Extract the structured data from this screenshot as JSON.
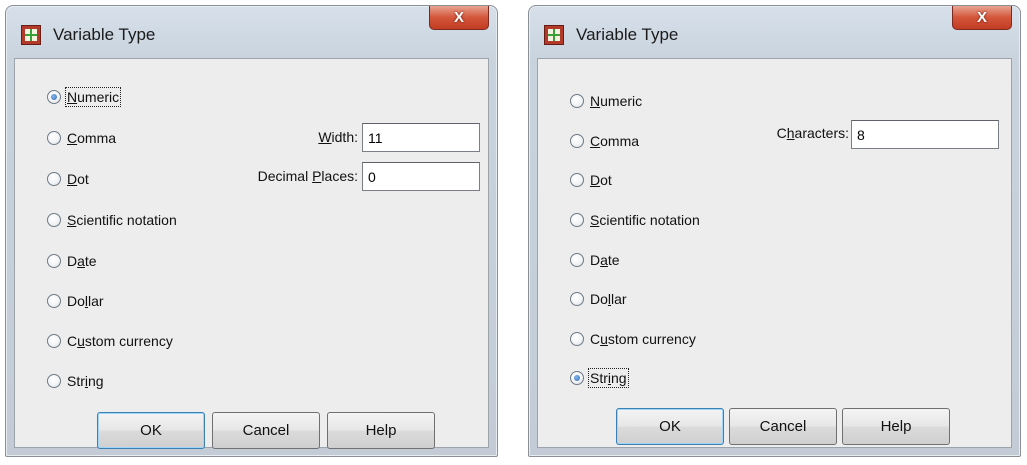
{
  "dialogs": [
    {
      "title": "Variable Type",
      "close_label": "X",
      "options": [
        {
          "pre": "",
          "key": "N",
          "post": "umeric",
          "selected": true
        },
        {
          "pre": "",
          "key": "C",
          "post": "omma",
          "selected": false
        },
        {
          "pre": "",
          "key": "D",
          "post": "ot",
          "selected": false
        },
        {
          "pre": "",
          "key": "S",
          "post": "cientific notation",
          "selected": false
        },
        {
          "pre": "D",
          "key": "a",
          "post": "te",
          "selected": false
        },
        {
          "pre": "Do",
          "key": "l",
          "post": "lar",
          "selected": false
        },
        {
          "pre": "C",
          "key": "u",
          "post": "stom currency",
          "selected": false
        },
        {
          "pre": "Str",
          "key": "i",
          "post": "ng",
          "selected": false
        }
      ],
      "width": {
        "pre": "",
        "key": "W",
        "post": "idth:",
        "value": "11"
      },
      "decimals": {
        "pre": "Decimal ",
        "key": "P",
        "post": "laces:",
        "value": "0"
      },
      "buttons": {
        "ok": "OK",
        "cancel": "Cancel",
        "help": "Help"
      }
    },
    {
      "title": "Variable Type",
      "close_label": "X",
      "options": [
        {
          "pre": "",
          "key": "N",
          "post": "umeric",
          "selected": false
        },
        {
          "pre": "",
          "key": "C",
          "post": "omma",
          "selected": false
        },
        {
          "pre": "",
          "key": "D",
          "post": "ot",
          "selected": false
        },
        {
          "pre": "",
          "key": "S",
          "post": "cientific notation",
          "selected": false
        },
        {
          "pre": "D",
          "key": "a",
          "post": "te",
          "selected": false
        },
        {
          "pre": "Do",
          "key": "l",
          "post": "lar",
          "selected": false
        },
        {
          "pre": "C",
          "key": "u",
          "post": "stom currency",
          "selected": false
        },
        {
          "pre": "Str",
          "key": "i",
          "post": "ng",
          "selected": true
        }
      ],
      "characters": {
        "pre": "C",
        "key": "h",
        "post": "aracters:",
        "value": "8"
      },
      "buttons": {
        "ok": "OK",
        "cancel": "Cancel",
        "help": "Help"
      }
    }
  ]
}
